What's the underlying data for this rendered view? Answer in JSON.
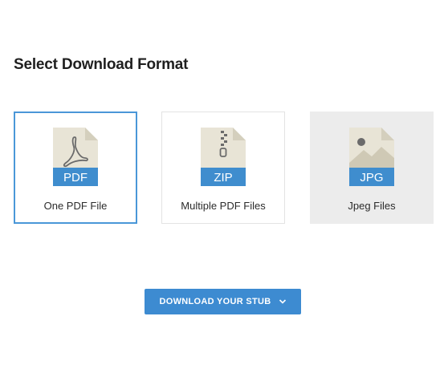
{
  "heading": "Select Download Format",
  "formats": [
    {
      "badge": "PDF",
      "label": "One PDF File",
      "icon": "pdf-file-icon",
      "state": "selected"
    },
    {
      "badge": "ZIP",
      "label": "Multiple PDF Files",
      "icon": "zip-file-icon",
      "state": "normal"
    },
    {
      "badge": "JPG",
      "label": "Jpeg Files",
      "icon": "image-file-icon",
      "state": "disabled"
    }
  ],
  "download_button": {
    "label": "DOWNLOAD YOUR STUB",
    "icon": "chevron-down-icon"
  },
  "colors": {
    "accent": "#3d8bd1",
    "selected_border": "#4a97d8",
    "doc_body": "#e8e4d6",
    "doc_fold": "#d4cfbd",
    "badge": "#3f8dce"
  }
}
